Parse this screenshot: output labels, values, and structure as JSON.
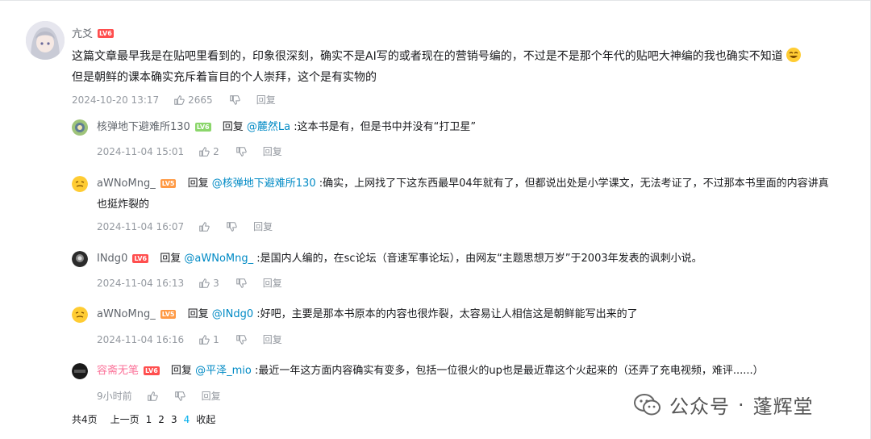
{
  "main": {
    "user": "亢爻",
    "level": "LV6",
    "line1": "这篇文章最早我是在贴吧里看到的，印象很深刻，确实不是AI写的或者现在的营销号编的，不过是不是那个年代的贴吧大神编的我也确实不知道",
    "line2": "但是朝鲜的课本确实充斥着盲目的个人崇拜，这个是有实物的",
    "time": "2024-10-20 13:17",
    "likes": "2665",
    "reply_label": "回复"
  },
  "replies": [
    {
      "user": "核弹地下避难所130",
      "level": "LV6",
      "reply_prefix": "回复",
      "mention": "@麓然La",
      "text": ":这本书是有，但是书中并没有“打卫星”",
      "time": "2024-11-04 15:01",
      "likes": "2",
      "reply_label": "回复"
    },
    {
      "user": "aWNoMng_",
      "level": "LV5",
      "reply_prefix": "回复",
      "mention": "@核弹地下避难所130",
      "text": ":确实，上网找了下这东西最早04年就有了，但都说出处是小学课文，无法考证了，不过那本书里面的内容讲真",
      "text2": "也挺炸裂的",
      "time": "2024-11-04 16:07",
      "likes": "",
      "reply_label": "回复"
    },
    {
      "user": "INdg0",
      "level": "LV6",
      "reply_prefix": "回复",
      "mention": "@aWNoMng_",
      "text": ":是国内人编的，在sc论坛（音速军事论坛），由网友“主题思想万岁”于2003年发表的讽刺小说。",
      "time": "2024-11-04 16:13",
      "likes": "3",
      "reply_label": "回复"
    },
    {
      "user": "aWNoMng_",
      "level": "LV5",
      "reply_prefix": "回复",
      "mention": "@INdg0",
      "text": ":好吧，主要是那本书原本的内容也很炸裂，太容易让人相信这是朝鲜能写出来的了",
      "time": "2024-11-04 16:16",
      "likes": "1",
      "reply_label": "回复"
    },
    {
      "user": "容斋无笔",
      "level": "LV6",
      "reply_prefix": "回复",
      "mention": "@平泽_mio",
      "text": ":最近一年这方面内容确实有变多，包括一位很火的up也是最近靠这个火起来的（还弄了充电视频，难评......）",
      "time": "9小时前",
      "likes": "",
      "reply_label": "回复"
    }
  ],
  "pager": {
    "total": "共4页",
    "prev": "上一页",
    "pages": [
      "1",
      "2",
      "3",
      "4"
    ],
    "current": "4",
    "collapse": "收起"
  },
  "watermark": {
    "left": "公众号",
    "dot": "·",
    "right": "蓬辉堂"
  },
  "colors": {
    "mention": "#008ac5",
    "meta": "#9499a0",
    "lv6": "#ff4e4e",
    "lv5": "#ff9a45",
    "vip_name": "#fb7299",
    "page_current": "#00aeec"
  },
  "icons": [
    "like-icon",
    "dislike-icon",
    "wechat-icon",
    "laugh-emoji-icon"
  ]
}
